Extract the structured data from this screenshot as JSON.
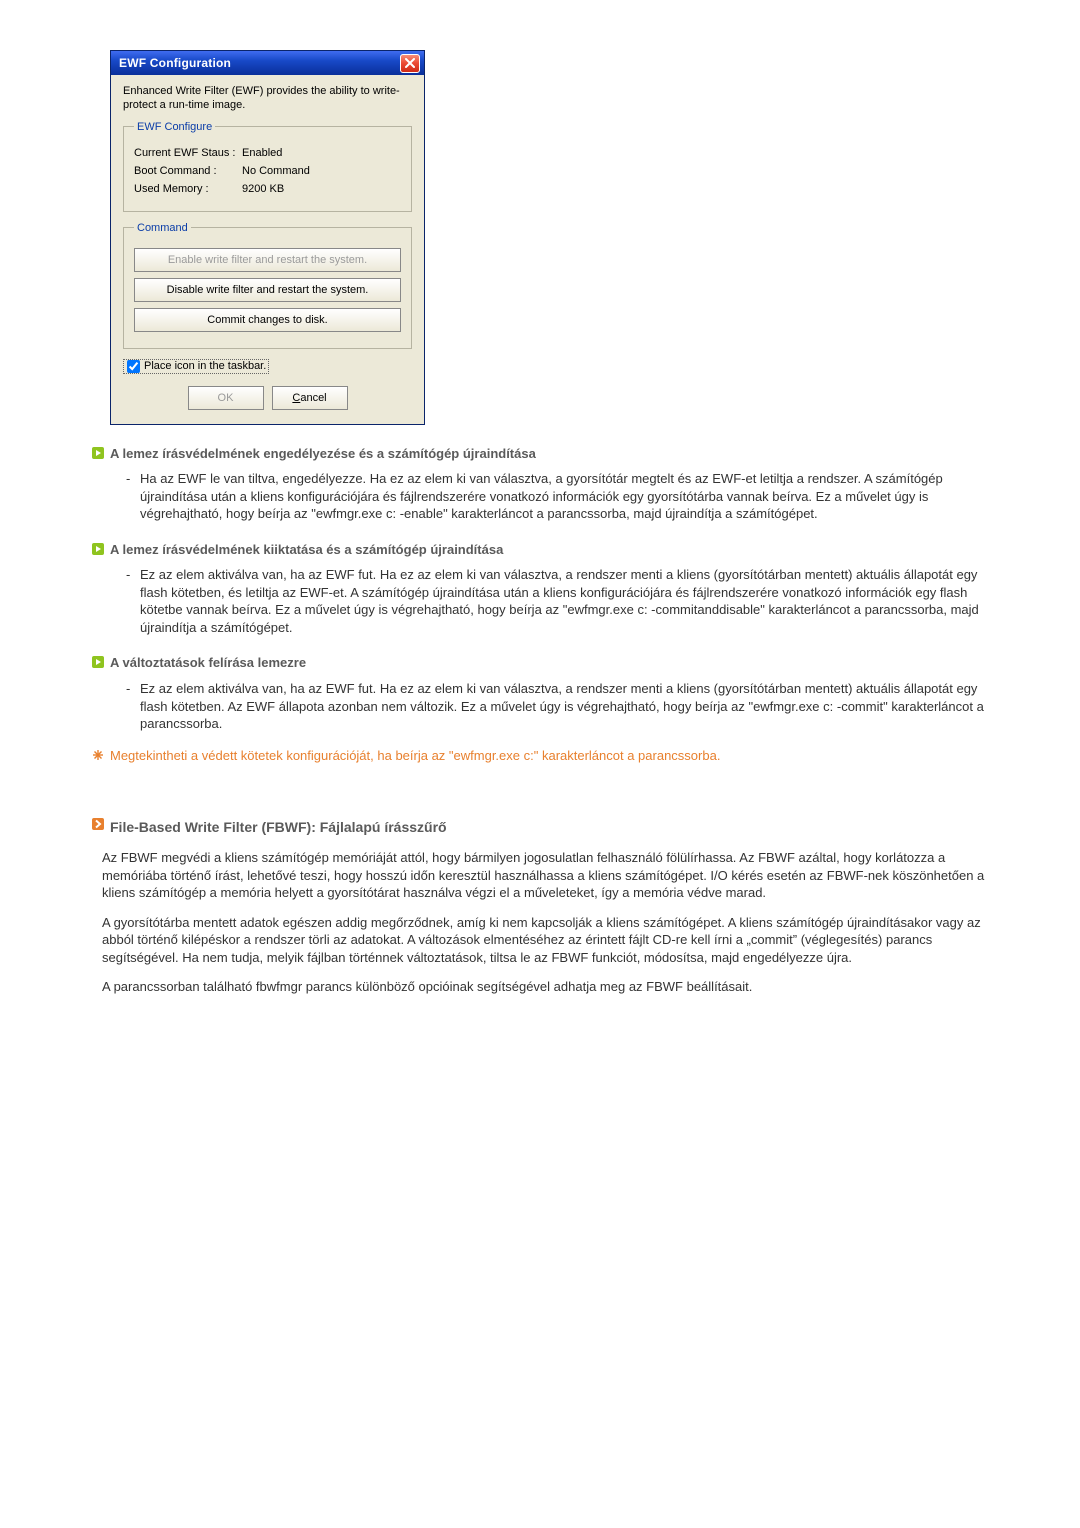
{
  "dialog": {
    "title": "EWF Configuration",
    "intro": "Enhanced Write Filter (EWF) provides the ability to write-protect a run-time image.",
    "config_group": {
      "legend": "EWF Configure",
      "rows": {
        "status_label": "Current EWF Staus :",
        "status_value": "Enabled",
        "boot_label": "Boot Command :",
        "boot_value": "No Command",
        "mem_label": "Used Memory :",
        "mem_value": "9200 KB"
      }
    },
    "command_group": {
      "legend": "Command",
      "enable_btn": "Enable write filter and restart the system.",
      "disable_btn": "Disable write filter and restart the system.",
      "commit_btn": "Commit changes to disk."
    },
    "checkbox_label": "Place icon in the taskbar.",
    "ok_label": "OK",
    "cancel_prefix": "C",
    "cancel_rest": "ancel"
  },
  "content": {
    "sec1": {
      "title": "A lemez írásvédelmének engedélyezése és a számítógép újraindítása",
      "item": "Ha az EWF le van tiltva, engedélyezze. Ha ez az elem ki van választva, a gyorsítótár megtelt és az EWF-et letiltja a rendszer. A számítógép újraindítása után a kliens konfigurációjára és fájlrendszerére vonatkozó információk egy gyorsítótárba vannak beírva. Ez a művelet úgy is végrehajtható, hogy beírja az \"ewfmgr.exe c: -enable\" karakterláncot a parancssorba, majd újraindítja a számítógépet."
    },
    "sec2": {
      "title": "A lemez írásvédelmének kiiktatása és a számítógép újraindítása",
      "item": "Ez az elem aktiválva van, ha az EWF fut. Ha ez az elem ki van választva, a rendszer menti a kliens (gyorsítótárban mentett) aktuális állapotát egy flash kötetben, és letiltja az EWF-et. A számítógép újraindítása után a kliens konfigurációjára és fájlrendszerére vonatkozó információk egy flash kötetbe vannak beírva. Ez a művelet úgy is végrehajtható, hogy beírja az \"ewfmgr.exe c: -commitanddisable\" karakterláncot a parancssorba, majd újraindítja a számítógépet."
    },
    "sec3": {
      "title": "A változtatások felírása lemezre",
      "item": "Ez az elem aktiválva van, ha az EWF fut. Ha ez az elem ki van választva, a rendszer menti a kliens (gyorsítótárban mentett) aktuális állapotát egy flash kötetben. Az EWF állapota azonban nem változik. Ez a művelet úgy is végrehajtható, hogy beírja az \"ewfmgr.exe c: -commit\" karakterláncot a parancssorba."
    },
    "note": "Megtekintheti a védett kötetek konfigurációját, ha beírja az \"ewfmgr.exe c:\" karakterláncot a parancssorba.",
    "sec4": {
      "title": "File-Based Write Filter (FBWF): Fájlalapú írásszűrő",
      "p1": "Az FBWF megvédi a kliens számítógép memóriáját attól, hogy bármilyen jogosulatlan felhasználó fölülírhassa. Az FBWF azáltal, hogy korlátozza a memóriába történő írást, lehetővé teszi, hogy hosszú időn keresztül használhassa a kliens számítógépet. I/O kérés esetén az FBWF-nek köszönhetően a kliens számítógép a memória helyett a gyorsítótárat használva végzi el a műveleteket, így a memória védve marad.",
      "p2": "A gyorsítótárba mentett adatok egészen addig megőrződnek, amíg ki nem kapcsolják a kliens számítógépet. A kliens számítógép újraindításakor vagy az abból történő kilépéskor a rendszer törli az adatokat. A változások elmentéséhez az érintett fájlt CD-re kell írni a „commit” (véglegesítés) parancs segítségével. Ha nem tudja, melyik fájlban történnek változtatások, tiltsa le az FBWF funkciót, módosítsa, majd engedélyezze újra.",
      "p3": "A parancssorban található fbwfmgr parancs különböző opcióinak segítségével adhatja meg az FBWF beállításait."
    }
  }
}
